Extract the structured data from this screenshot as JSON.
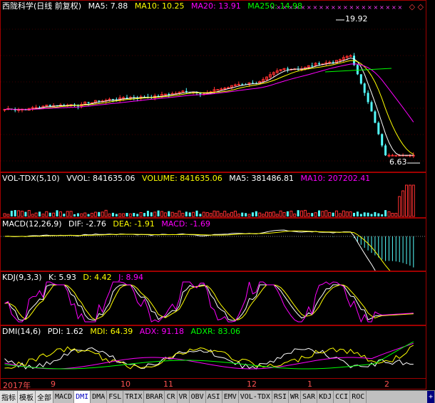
{
  "main": {
    "title": "西陇科学(日线 前复权)",
    "ma5": "MA5: 7.88",
    "ma10": "MA10: 10.25",
    "ma20": "MA20: 13.91",
    "ma250": "MA250: 14.98",
    "high_label": "19.92",
    "low_label": "6.63",
    "corner_icons": "◇ ◇"
  },
  "vol": {
    "name": "VOL-TDX(5,10)",
    "vvol": "VVOL: 841635.06",
    "volume": "VOLUME: 841635.06",
    "ma5": "MA5: 381486.81",
    "ma10": "MA10: 207202.41"
  },
  "macd": {
    "name": "MACD(12,26,9)",
    "dif": "DIF: -2.76",
    "dea": "DEA: -1.91",
    "macd": "MACD: -1.69"
  },
  "kdj": {
    "name": "KDJ(9,3,3)",
    "k": "K: 5.93",
    "d": "D: 4.42",
    "j": "J: 8.94"
  },
  "dmi": {
    "name": "DMI(14,6)",
    "pdi": "PDI: 1.62",
    "mdi": "MDI: 64.39",
    "adx": "ADX: 91.18",
    "adxr": "ADXR: 83.06"
  },
  "xaxis": [
    "2017年",
    "9",
    "10",
    "11",
    "12",
    "1",
    "2"
  ],
  "tabs": [
    "指标",
    "模板",
    "全部",
    "MACD",
    "DMI",
    "DMA",
    "FSL",
    "TRIX",
    "BRAR",
    "CR",
    "VR",
    "OBV",
    "ASI",
    "EMV",
    "VOL-TDX",
    "RSI",
    "WR",
    "SAR",
    "KDJ",
    "CCI",
    "ROC",
    "+"
  ],
  "active_tab": "DMI",
  "colors": {
    "up": "#ff3030",
    "down": "#54ffff",
    "ma5": "#ffffff",
    "ma10": "#ffff00",
    "ma20": "#ff00ff",
    "ma250": "#00ff00",
    "border": "#a00000"
  }
}
